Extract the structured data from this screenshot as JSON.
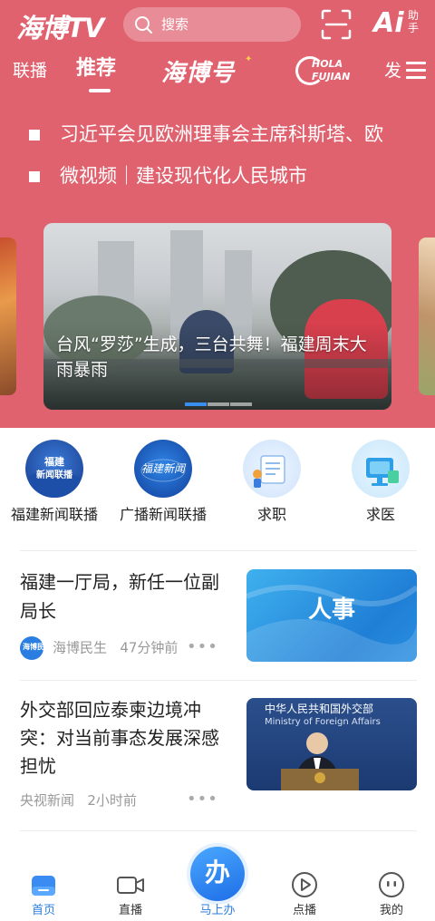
{
  "header": {
    "logo": "海博TV",
    "search_placeholder": "搜索",
    "assistant_glyph": "Ai",
    "assistant_label": "助手"
  },
  "tabs": [
    {
      "label": "联播"
    },
    {
      "label": "推荐",
      "active": true
    },
    {
      "label": "海博号"
    },
    {
      "label": "HOLA FUJIAN",
      "line1": "HOLA",
      "line2": "FUJIAN"
    },
    {
      "label": "发"
    }
  ],
  "headlines": [
    "习近平会见欧洲理事会主席科斯塔、欧",
    "微视频｜建设现代化人民城市"
  ],
  "carousel": {
    "caption": "台风“罗莎”生成，三台共舞！福建周末大雨暴雨",
    "slide_count": 3,
    "active_index": 0
  },
  "quick_entries": [
    {
      "label": "福建新闻联播",
      "icon_text": "福建新闻联播",
      "icon": "fujian-news-logo"
    },
    {
      "label": "广播新闻联播",
      "icon_text": "福建新闻",
      "icon": "radio-news-logo"
    },
    {
      "label": "求职",
      "icon": "job-search-icon"
    },
    {
      "label": "求医",
      "icon": "medical-icon"
    }
  ],
  "news": [
    {
      "title": "福建一厅局，新任一位副局长",
      "source": "海博民生",
      "source_avatar_text": "海博民生",
      "time": "47分钟前",
      "thumb_text": "人事",
      "more": "•••"
    },
    {
      "title": "外交部回应泰柬边境冲突：对当前事态发展深感担忧",
      "source": "央视新闻",
      "time": "2小时前",
      "thumb_text": "中华人民共和国外交部",
      "thumb_subtext": "Ministry of Foreign Affairs",
      "more": "•••"
    }
  ],
  "bottom_nav": [
    {
      "label": "首页",
      "icon": "home-icon",
      "active": true
    },
    {
      "label": "直播",
      "icon": "live-camera-icon"
    },
    {
      "label": "马上办",
      "icon": "ban-icon",
      "glyph": "办"
    },
    {
      "label": "点播",
      "icon": "play-icon"
    },
    {
      "label": "我的",
      "icon": "profile-icon"
    }
  ],
  "colors": {
    "header_bg": "#e0626f",
    "accent": "#2a7de1"
  }
}
